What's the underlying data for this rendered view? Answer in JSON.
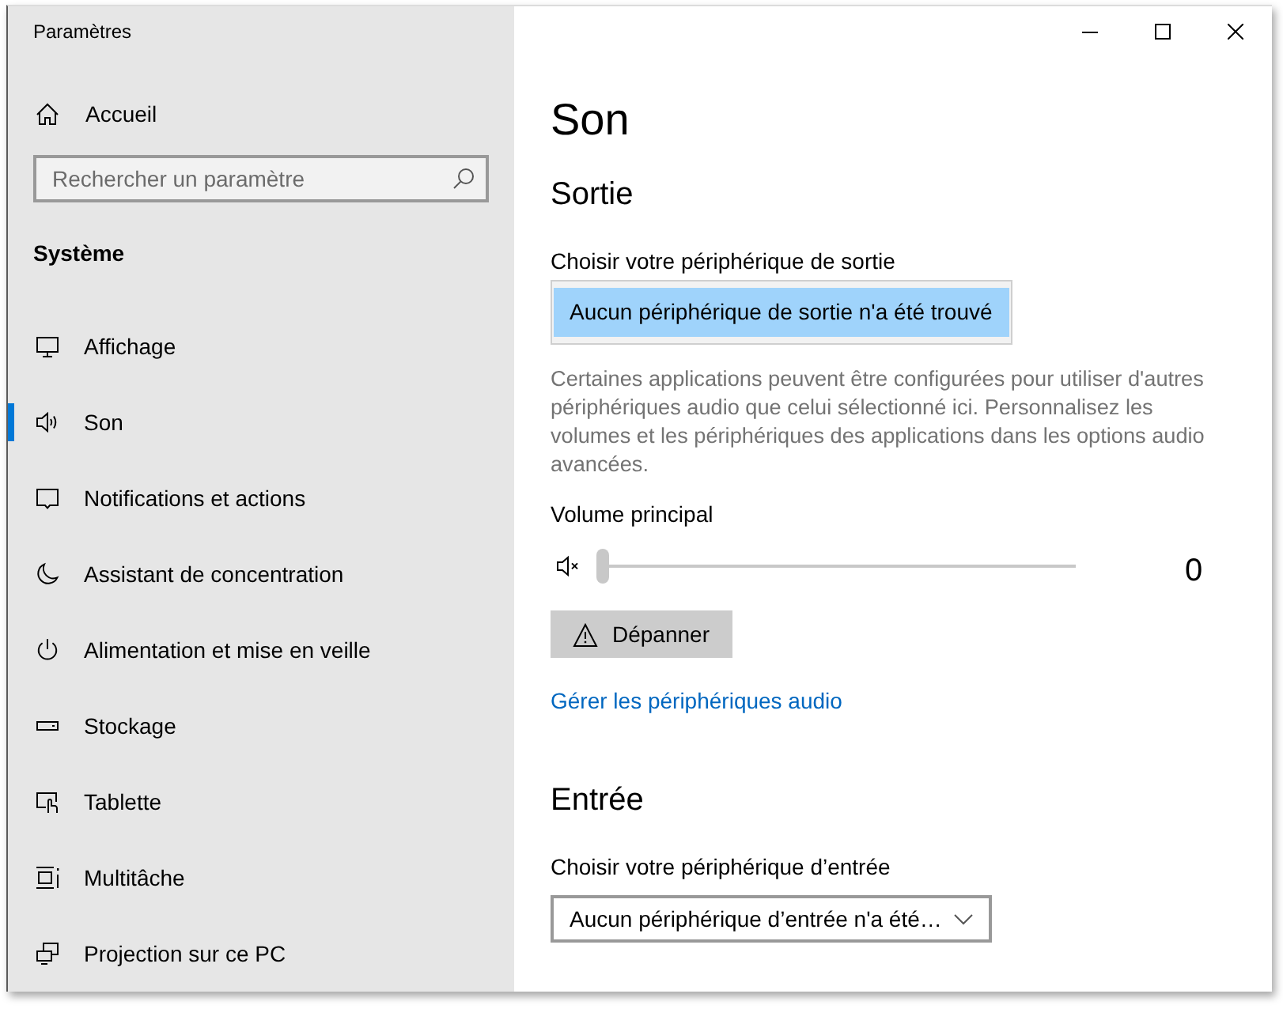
{
  "window": {
    "title": "Paramètres"
  },
  "sidebar": {
    "home": "Accueil",
    "search": {
      "placeholder": "Rechercher un paramètre"
    },
    "section": "Système",
    "items": [
      {
        "label": "Affichage",
        "selected": false
      },
      {
        "label": "Son",
        "selected": true
      },
      {
        "label": "Notifications et actions",
        "selected": false
      },
      {
        "label": "Assistant de concentration",
        "selected": false
      },
      {
        "label": "Alimentation et mise en veille",
        "selected": false
      },
      {
        "label": "Stockage",
        "selected": false
      },
      {
        "label": "Tablette",
        "selected": false
      },
      {
        "label": "Multitâche",
        "selected": false
      },
      {
        "label": "Projection sur ce PC",
        "selected": false
      }
    ]
  },
  "main": {
    "title": "Son",
    "output": {
      "heading": "Sortie",
      "device_label": "Choisir votre périphérique de sortie",
      "device": {
        "value": "Aucun périphérique de sortie n'a été trouvé",
        "selected": true
      },
      "description": "Certaines applications peuvent être configurées pour utiliser d'autres périphériques audio que celui sélectionné ici. Personnalisez les volumes et les périphériques des applications dans les options audio avancées.",
      "volume": {
        "label": "Volume principal",
        "muted": true,
        "level": 0,
        "reading": "0"
      },
      "troubleshoot_button": "Dépanner",
      "link": "Gérer les périphériques audio"
    },
    "input": {
      "heading": "Entrée",
      "device_label": "Choisir votre périphérique d’entrée",
      "device": {
        "value": "Aucun périphérique d’entrée n'a été…"
      }
    }
  }
}
